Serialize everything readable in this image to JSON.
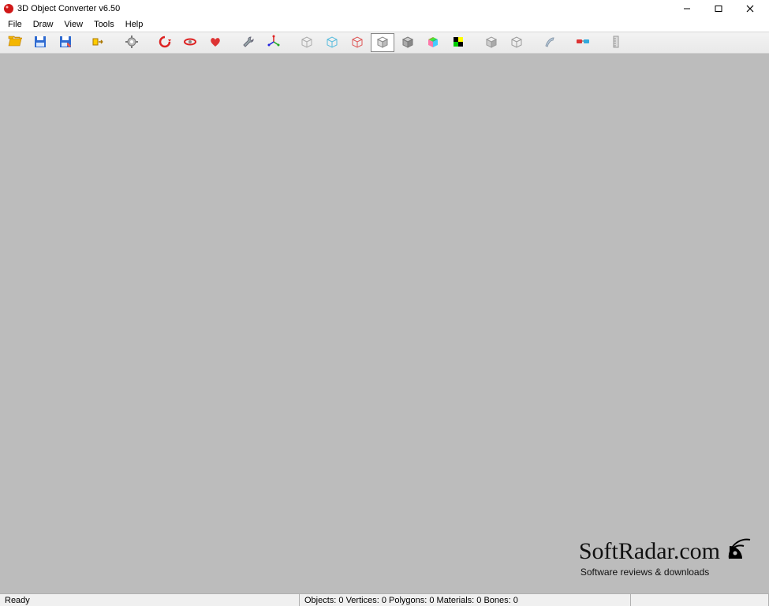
{
  "titlebar": {
    "title": "3D Object Converter v6.50"
  },
  "menu": {
    "items": [
      {
        "label": "File"
      },
      {
        "label": "Draw"
      },
      {
        "label": "View"
      },
      {
        "label": "Tools"
      },
      {
        "label": "Help"
      }
    ]
  },
  "toolbar": {
    "buttons": [
      {
        "name": "open-icon"
      },
      {
        "name": "save-icon"
      },
      {
        "name": "save-as-icon"
      },
      {
        "name": "batch-convert-icon"
      },
      {
        "name": "settings-icon"
      },
      {
        "name": "rotate-red-icon"
      },
      {
        "name": "rotate-ring-icon"
      },
      {
        "name": "rotate-heart-icon"
      },
      {
        "name": "tool-wrench-icon"
      },
      {
        "name": "axes-icon"
      },
      {
        "name": "wire-cube-grey-icon"
      },
      {
        "name": "wire-cube-blue-icon"
      },
      {
        "name": "wire-cube-red-icon"
      },
      {
        "name": "shaded-cube-white-icon"
      },
      {
        "name": "shaded-cube-grey-icon"
      },
      {
        "name": "gradient-cube-icon"
      },
      {
        "name": "checker-cube-icon"
      },
      {
        "name": "cube-plain-icon"
      },
      {
        "name": "cube-outline-icon"
      },
      {
        "name": "paint-icon"
      },
      {
        "name": "glasses-3d-icon"
      },
      {
        "name": "ruler-icon"
      }
    ]
  },
  "status": {
    "ready": "Ready",
    "info": "Objects: 0   Vertices: 0   Polygons: 0   Materials: 0   Bones: 0"
  },
  "watermark": {
    "line1": "SoftRadar.com",
    "line2": "Software reviews & downloads"
  }
}
